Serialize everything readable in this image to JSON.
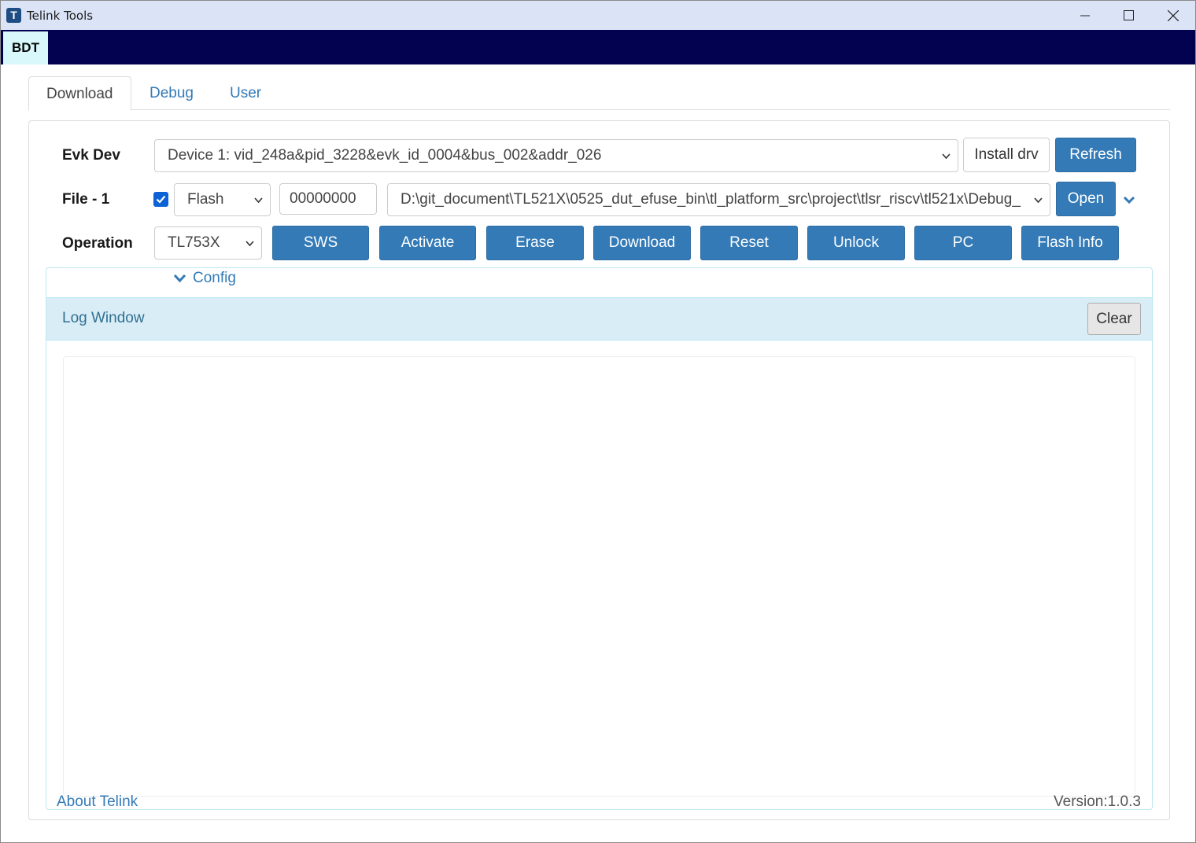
{
  "window": {
    "title": "Telink Tools",
    "icon_letter": "T"
  },
  "appbar": {
    "active_tab": "BDT"
  },
  "tabs": [
    {
      "label": "Download"
    },
    {
      "label": "Debug"
    },
    {
      "label": "User"
    }
  ],
  "evk": {
    "label": "Evk Dev",
    "device": "Device 1: vid_248a&pid_3228&evk_id_0004&bus_002&addr_026",
    "install_label": "Install drv",
    "refresh_label": "Refresh"
  },
  "file": {
    "label": "File - 1",
    "checked": true,
    "type": "Flash",
    "address": "00000000",
    "path": "D:\\git_document\\TL521X\\0525_dut_efuse_bin\\tl_platform_src\\project\\tlsr_riscv\\tl521x\\Debug_",
    "open_label": "Open"
  },
  "operation": {
    "label": "Operation",
    "chip": "TL753X",
    "buttons": [
      "SWS",
      "Activate",
      "Erase",
      "Download",
      "Reset",
      "Unlock",
      "PC",
      "Flash Info"
    ]
  },
  "config": {
    "label": "Config"
  },
  "log": {
    "title": "Log Window",
    "clear_label": "Clear",
    "content": ""
  },
  "footer": {
    "about": "About Telink",
    "version": "Version:1.0.3"
  },
  "colors": {
    "primary": "#337ab7",
    "appbar": "#020250",
    "titlebar": "#dbe4f7",
    "log_header": "#d9edf7"
  }
}
